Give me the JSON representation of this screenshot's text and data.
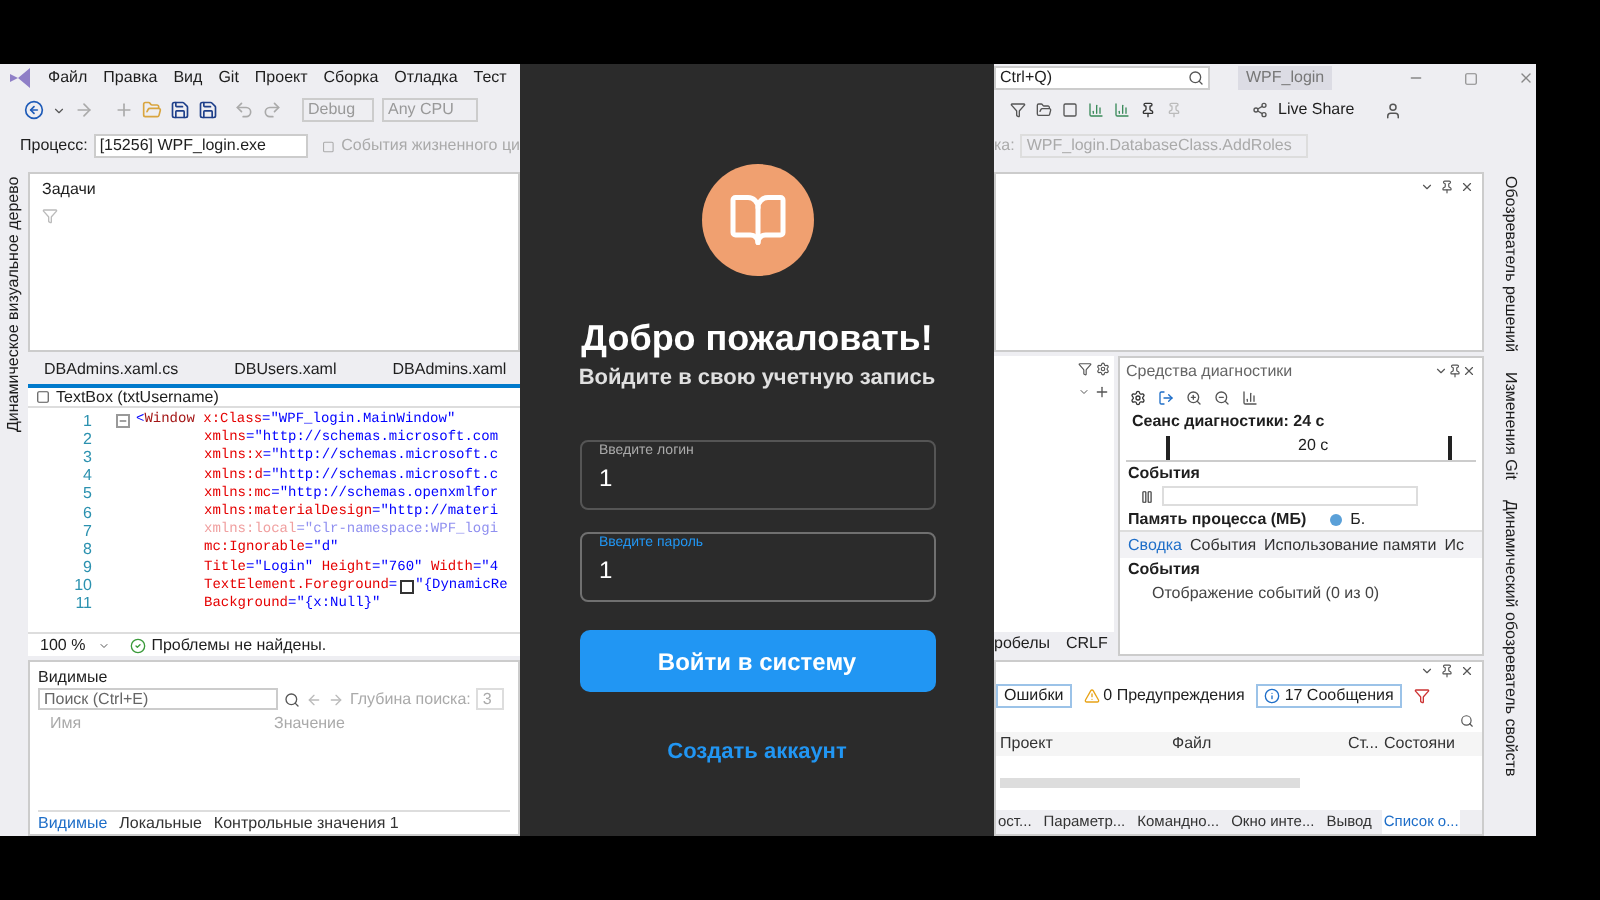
{
  "ide": {
    "menu": [
      "Файл",
      "Правка",
      "Вид",
      "Git",
      "Проект",
      "Сборка",
      "Отладка",
      "Тест"
    ],
    "search_hint": "Ctrl+Q)",
    "window_title": "WPF_login",
    "toolbar": {
      "configuration": "Debug",
      "platform": "Any CPU",
      "live_share": "Live Share"
    },
    "process": {
      "label": "Процесс:",
      "value": "[15256] WPF_login.exe",
      "lifecycle": "События жизненного ци"
    },
    "stack_frame": {
      "label": "ка:",
      "value": "WPF_login.DatabaseClass.AddRoles"
    },
    "left_strip": "Динамическое визуальное дерево",
    "right_strip": [
      "Обозреватель решений",
      "Изменения Git",
      "Динамический обозреватель свойств"
    ],
    "tasks_panel": {
      "title": "Задачи"
    },
    "editor": {
      "tabs": [
        {
          "label": "DBAdmins.xaml.cs",
          "selected": false
        },
        {
          "label": "DBUsers.xaml",
          "selected": false
        },
        {
          "label": "DBAdmins.xaml",
          "selected": false
        }
      ],
      "element": "TextBox (txtUsername)",
      "lines": [
        {
          "number": "1",
          "segments": [
            {
              "kind": "punct",
              "text": "<"
            },
            {
              "kind": "tag",
              "text": "Window"
            },
            {
              "kind": "attr",
              "text": " x:Class"
            },
            {
              "kind": "punct",
              "text": "="
            },
            {
              "kind": "value",
              "text": "\"WPF_login.MainWindow\""
            }
          ],
          "children": [
            {
              "number": "2",
              "segments": [
                {
                  "kind": "attr",
                  "text": "xmlns"
                },
                {
                  "kind": "punct",
                  "text": "="
                },
                {
                  "kind": "value",
                  "text": "\"http://schemas.microsoft.com"
                }
              ]
            },
            {
              "number": "3",
              "segments": [
                {
                  "kind": "attr",
                  "text": "xmlns:x"
                },
                {
                  "kind": "punct",
                  "text": "="
                },
                {
                  "kind": "value",
                  "text": "\"http://schemas.microsoft.c"
                }
              ]
            },
            {
              "number": "4",
              "segments": [
                {
                  "kind": "attr",
                  "text": "xmlns:d"
                },
                {
                  "kind": "punct",
                  "text": "="
                },
                {
                  "kind": "value",
                  "text": "\"http://schemas.microsoft.c"
                }
              ]
            },
            {
              "number": "5",
              "segments": [
                {
                  "kind": "attr",
                  "text": "xmlns:mc"
                },
                {
                  "kind": "punct",
                  "text": "="
                },
                {
                  "kind": "value",
                  "text": "\"http://schemas.openxmlfor"
                }
              ]
            },
            {
              "number": "6",
              "segments": [
                {
                  "kind": "attr",
                  "text": "xmlns:materialDesign"
                },
                {
                  "kind": "punct",
                  "text": "="
                },
                {
                  "kind": "value",
                  "text": "\"http://materi"
                }
              ]
            },
            {
              "number": "7",
              "segments": [
                {
                  "kind": "faded_attr",
                  "text": "xmlns:local"
                },
                {
                  "kind": "faded_punct",
                  "text": "="
                },
                {
                  "kind": "faded_value",
                  "text": "\"clr-namespace:WPF_logi"
                }
              ]
            },
            {
              "number": "8",
              "segments": [
                {
                  "kind": "attr",
                  "text": "mc:Ignorable"
                },
                {
                  "kind": "punct",
                  "text": "="
                },
                {
                  "kind": "value",
                  "text": "\"d\""
                }
              ]
            },
            {
              "number": "9",
              "segments": [
                {
                  "kind": "attr",
                  "text": "Title"
                },
                {
                  "kind": "punct",
                  "text": "="
                },
                {
                  "kind": "value",
                  "text": "\"Login\""
                },
                {
                  "kind": "attr",
                  "text": " Height"
                },
                {
                  "kind": "punct",
                  "text": "="
                },
                {
                  "kind": "value",
                  "text": "\"760\""
                },
                {
                  "kind": "attr",
                  "text": " Width"
                },
                {
                  "kind": "punct",
                  "text": "="
                },
                {
                  "kind": "value",
                  "text": "\"4"
                }
              ]
            },
            {
              "number": "10",
              "segments": [
                {
                  "kind": "attr",
                  "text": "TextElement.Foreground"
                },
                {
                  "kind": "punct",
                  "text": "="
                },
                {
                  "kind": "swatch"
                },
                {
                  "kind": "value",
                  "text": "\"{DynamicRe"
                }
              ]
            },
            {
              "number": "11",
              "segments": [
                {
                  "kind": "attr",
                  "text": "Background"
                },
                {
                  "kind": "punct",
                  "text": "="
                },
                {
                  "kind": "value",
                  "text": "\"{x:Null}\""
                }
              ]
            }
          ]
        }
      ],
      "zoom": "100 %",
      "status": "Проблемы не найдены.",
      "status_right": [
        "робелы",
        "CRLF"
      ]
    },
    "locals": {
      "title": "Видимые",
      "search_placeholder": "Поиск (Ctrl+E)",
      "depth_label": "Глубина поиска:",
      "depth": "3",
      "columns": [
        "Имя",
        "Значение"
      ],
      "tabs": [
        {
          "label": "Видимые",
          "selected": true
        },
        {
          "label": "Локальные",
          "selected": false
        },
        {
          "label": "Контрольные значения 1",
          "selected": false
        }
      ]
    },
    "diagnostics": {
      "title": "Средства диагностики",
      "session": "Сеанс диагностики: 24 с",
      "tick": "20 с",
      "events_section": "События",
      "memory_section": "Память процесса (МБ)",
      "memory_legend": "Б.",
      "tabs": [
        {
          "label": "Сводка",
          "selected": true
        },
        {
          "label": "События",
          "selected": false
        },
        {
          "label": "Использование памяти",
          "selected": false
        },
        {
          "label": "Ис",
          "selected": false
        }
      ],
      "events_heading": "События",
      "events_row": "Отображение событий (0 из 0)"
    },
    "error_list": {
      "filters": [
        {
          "kind": "errors",
          "label": "Ошибки"
        },
        {
          "kind": "warnings",
          "label": "0 Предупреждения"
        },
        {
          "kind": "messages",
          "label": "17 Сообщения"
        }
      ],
      "columns": [
        "Проект",
        "Файл",
        "Ст...",
        "Состояни"
      ],
      "tabs": [
        {
          "label": "ост...",
          "selected": false
        },
        {
          "label": "Параметр...",
          "selected": false
        },
        {
          "label": "Командно...",
          "selected": false
        },
        {
          "label": "Окно инте...",
          "selected": false
        },
        {
          "label": "Вывод",
          "selected": false
        },
        {
          "label": "Список о...",
          "selected": true
        }
      ]
    }
  },
  "login": {
    "title": "Добро пожаловать!",
    "subtitle": "Войдите в свою учетную запись",
    "fields": [
      {
        "label": "Введите логин",
        "value": "1",
        "focused": false
      },
      {
        "label": "Введите пароль",
        "value": "1",
        "focused": true
      }
    ],
    "button": "Войти в систему",
    "link": "Создать аккаунт"
  }
}
